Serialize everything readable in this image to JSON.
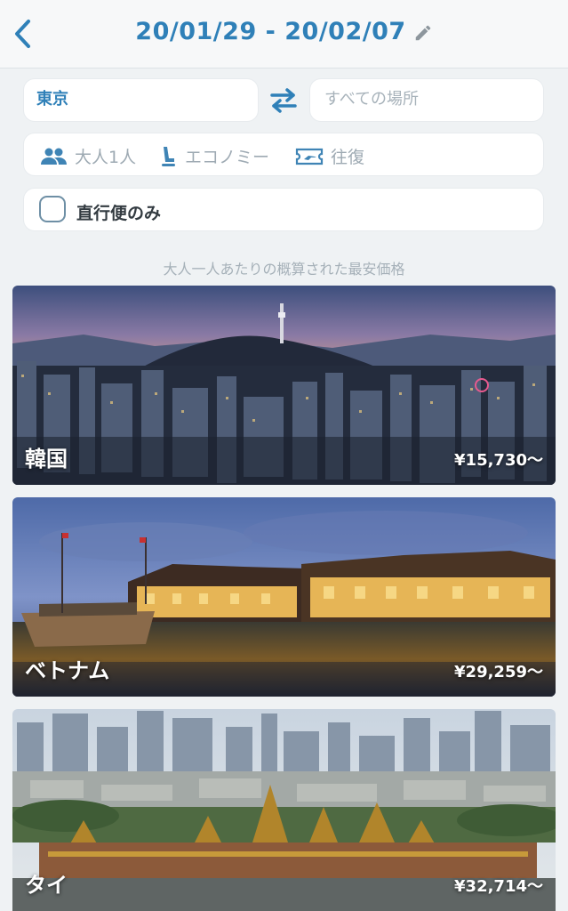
{
  "header": {
    "date_range": "20/01/29 - 20/02/07"
  },
  "search": {
    "origin": "東京",
    "destination_placeholder": "すべての場所",
    "passengers": "大人1人",
    "cabin_class": "エコノミー",
    "trip_type": "往復",
    "direct_only_label": "直行便のみ",
    "direct_only_checked": false
  },
  "caption": "大人一人あたりの概算された最安価格",
  "destinations": [
    {
      "name": "韓国",
      "price": "¥15,730〜"
    },
    {
      "name": "ベトナム",
      "price": "¥29,259〜"
    },
    {
      "name": "タイ",
      "price": "¥32,714〜"
    }
  ],
  "colors": {
    "accent": "#2f80b8",
    "background": "#eff2f4",
    "muted_text": "#9eaab3"
  },
  "icons": [
    "back-chevron-icon",
    "pencil-icon",
    "swap-arrows-icon",
    "people-icon",
    "seat-icon",
    "ticket-icon"
  ]
}
